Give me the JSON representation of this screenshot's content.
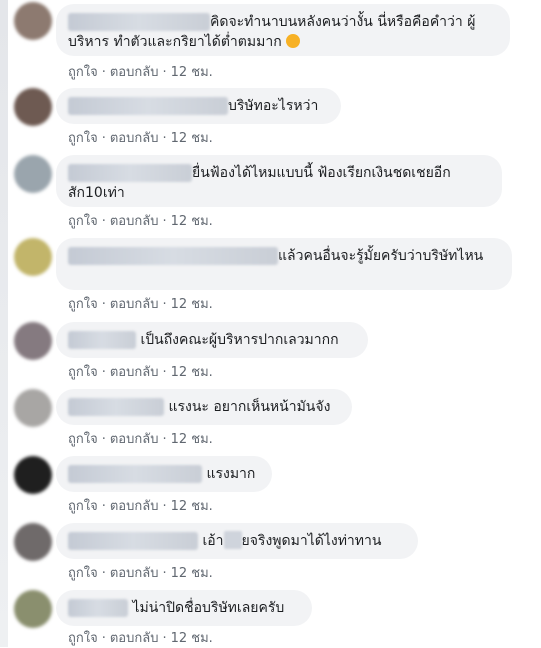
{
  "comments": [
    {
      "text": "คิดจะทำนาบนหลังคนว่างั้น นี่หรือคือคำว่า ผู้บริหาร ทำตัวและกริยาได้ต่ำตมมาก",
      "like": "ถูกใจ",
      "reply": "ตอบกลับ",
      "time": "12 ชม.",
      "emoji": "angry-face"
    },
    {
      "text": "บริษัทอะไรหว่า",
      "like": "ถูกใจ",
      "reply": "ตอบกลับ",
      "time": "12 ชม."
    },
    {
      "text": "ยื่นฟ้องได้ไหมแบบนี้ ฟ้องเรียกเงินชดเชยอีกสัก10เท่า",
      "like": "ถูกใจ",
      "reply": "ตอบกลับ",
      "time": "12 ชม."
    },
    {
      "text": "แล้วคนอื่นจะรู้มั้ยครับว่าบริษัทไหน",
      "like": "ถูกใจ",
      "reply": "ตอบกลับ",
      "time": "12 ชม."
    },
    {
      "text": "เป็นถึงคณะผู้บริหารปากเลวมากก",
      "like": "ถูกใจ",
      "reply": "ตอบกลับ",
      "time": "12 ชม."
    },
    {
      "text": "แรงนะ อยากเห็นหน้ามันจัง",
      "like": "ถูกใจ",
      "reply": "ตอบกลับ",
      "time": "12 ชม."
    },
    {
      "text": "แรงมาก",
      "like": "ถูกใจ",
      "reply": "ตอบกลับ",
      "time": "12 ชม."
    },
    {
      "text_before": "เอ้า",
      "text_after": "ยจริงพูดมาได้ไงท่าทาน",
      "like": "ถูกใจ",
      "reply": "ตอบกลับ",
      "time": "12 ชม."
    },
    {
      "text": "ไม่น่าปิดชื่อบริษัทเลยครับ",
      "like": "ถูกใจ",
      "reply": "ตอบกลับ",
      "time": "12 ชม."
    }
  ],
  "separator": "·"
}
